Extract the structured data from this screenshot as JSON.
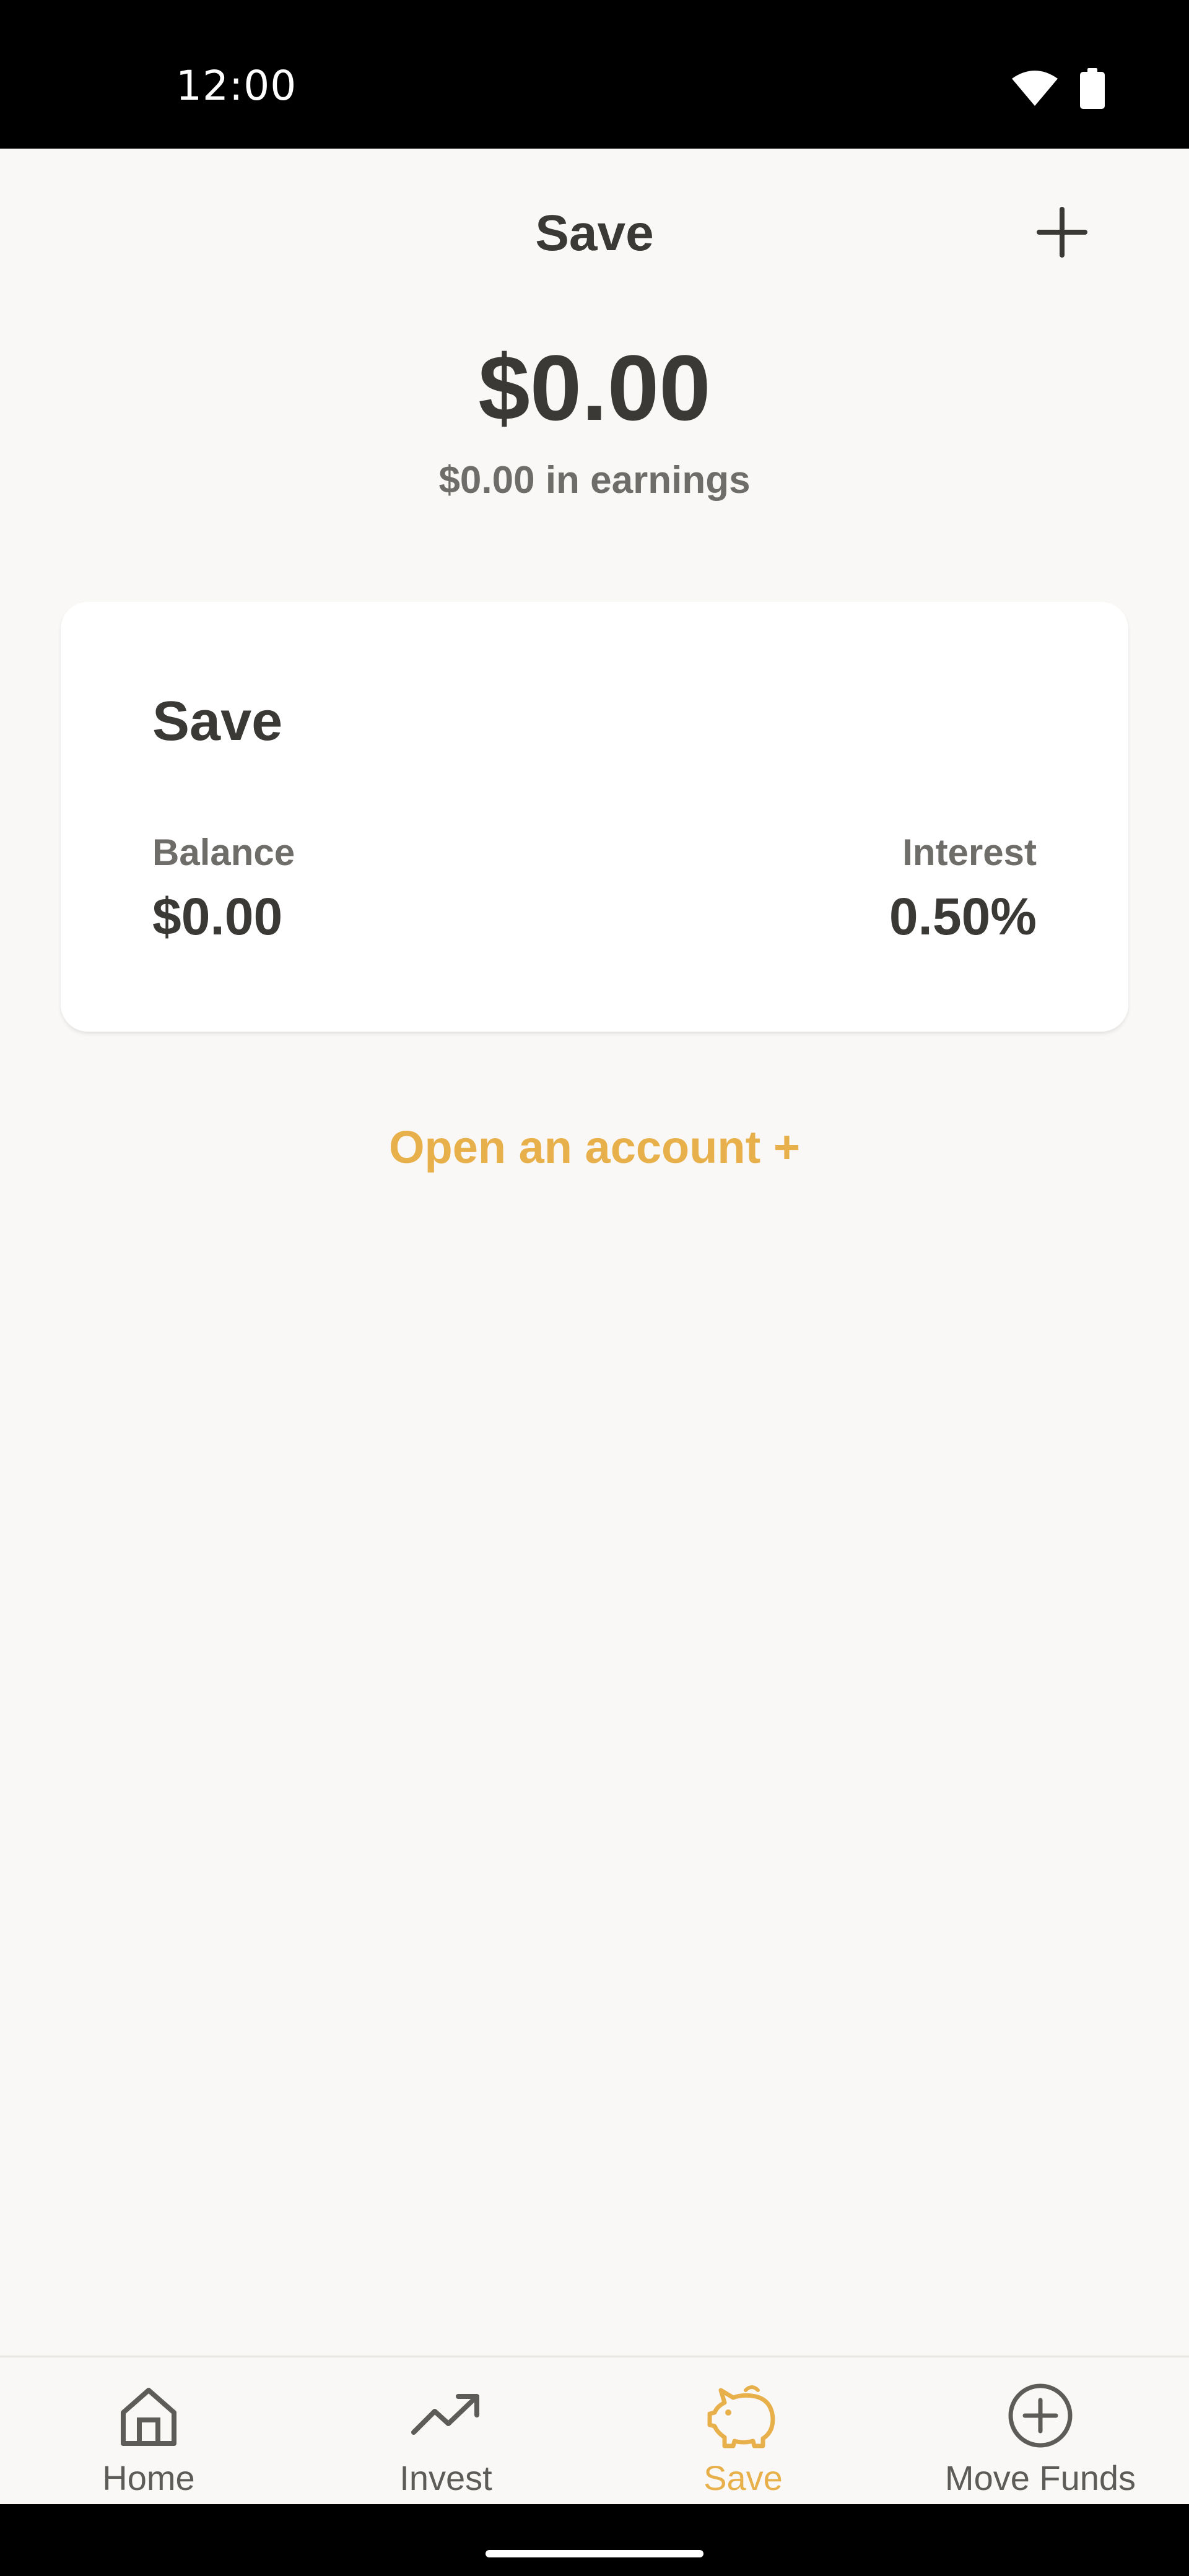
{
  "status_bar": {
    "time": "12:00",
    "icons": [
      "wifi-icon",
      "battery-icon"
    ]
  },
  "header": {
    "title": "Save",
    "action_icon": "plus-icon"
  },
  "summary": {
    "total": "$0.00",
    "earnings": "$0.00 in earnings"
  },
  "account_card": {
    "title": "Save",
    "balance_label": "Balance",
    "balance_value": "$0.00",
    "interest_label": "Interest",
    "interest_value": "0.50%"
  },
  "open_account_label": "Open an account +",
  "bottom_nav": {
    "items": [
      {
        "label": "Home",
        "icon": "home-icon",
        "active": false
      },
      {
        "label": "Invest",
        "icon": "trending-up-icon",
        "active": false
      },
      {
        "label": "Save",
        "icon": "piggy-bank-icon",
        "active": true
      },
      {
        "label": "Move Funds",
        "icon": "plus-circle-icon",
        "active": false
      }
    ]
  },
  "colors": {
    "accent": "#e8b04b",
    "text_primary": "#3a3936",
    "text_secondary": "#6f6d69",
    "background": "#f9f8f6"
  }
}
